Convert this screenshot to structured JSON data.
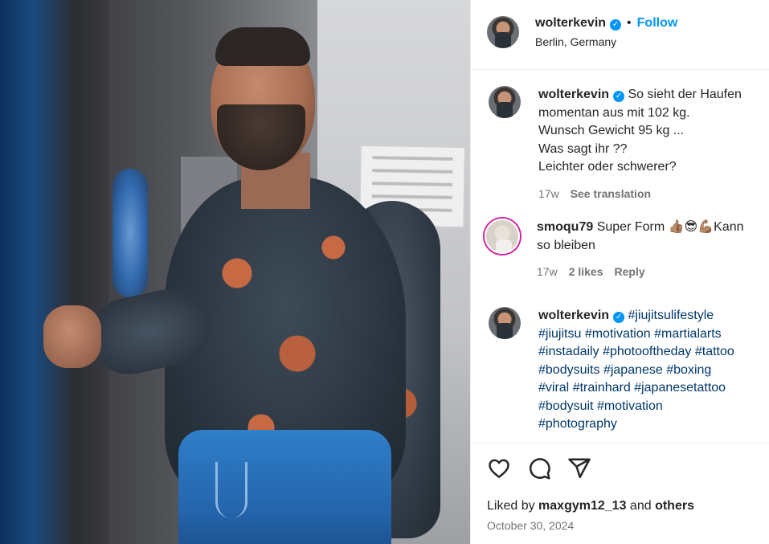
{
  "post": {
    "author": "wolterkevin",
    "location": "Berlin, Germany",
    "follow_label": "Follow",
    "separator": "•"
  },
  "caption": {
    "username": "wolterkevin",
    "lines": [
      "So sieht der Haufen",
      "momentan aus mit 102 kg.",
      "Wunsch Gewicht 95 kg ...",
      "Was sagt ihr ??",
      "Leichter oder schwerer?"
    ],
    "time": "17w",
    "see_translation": "See translation"
  },
  "comment_1": {
    "username": "smoqu79",
    "text_a": "Super Form",
    "emojis": "👍🏽😎💪🏽",
    "text_b": "Kann",
    "text_c": "so bleiben",
    "time": "17w",
    "likes": "2 likes",
    "reply": "Reply"
  },
  "comment_2": {
    "username": "wolterkevin",
    "hashtags": [
      "#jiujitsulifestyle",
      "#jiujitsu",
      "#motivation",
      "#martialarts",
      "#instadaily",
      "#photooftheday",
      "#tattoo",
      "#bodysuits",
      "#japanese",
      "#boxing",
      "#viral",
      "#trainhard",
      "#japanesetattoo",
      "#bodysuit",
      "#motivation",
      "#photography"
    ]
  },
  "footer": {
    "liked_prefix": "Liked by",
    "liked_user": "maxgym12_13",
    "liked_and": "and",
    "liked_others": "others",
    "date": "October 30, 2024"
  },
  "icons": {
    "verified": "verified-badge-icon",
    "like": "heart-icon",
    "comment": "comment-bubble-icon",
    "share": "paper-plane-icon"
  },
  "colors": {
    "accent": "#0095f6",
    "hashtag": "#00376b",
    "muted": "#737373",
    "text": "#262626"
  }
}
